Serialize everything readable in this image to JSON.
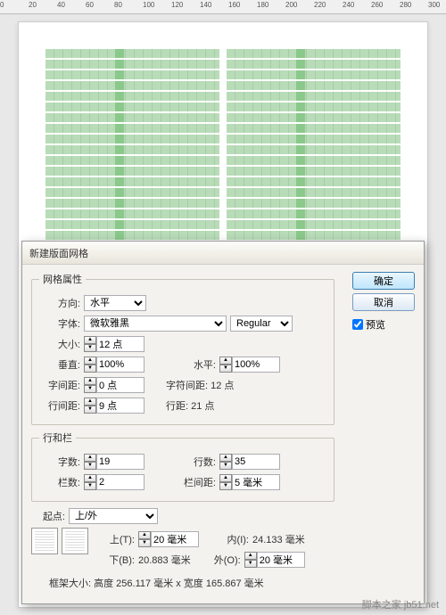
{
  "ruler": [
    "0",
    "20",
    "40",
    "60",
    "80",
    "100",
    "120",
    "140",
    "160",
    "180",
    "200",
    "220",
    "240",
    "260",
    "280",
    "300"
  ],
  "dialog": {
    "title": "新建版面网格",
    "grid_attr": {
      "legend": "网格属性",
      "direction_label": "方向:",
      "direction_value": "水平",
      "font_label": "字体:",
      "font_value": "微软雅黑",
      "font_weight": "Regular",
      "size_label": "大小:",
      "size_value": "12 点",
      "vert_label": "垂直:",
      "vert_value": "100%",
      "horiz_label": "水平:",
      "horiz_value": "100%",
      "char_gap_label": "字间距:",
      "char_gap_value": "0 点",
      "char_gap_info": "字符间距: 12 点",
      "line_gap_label": "行间距:",
      "line_gap_value": "9 点",
      "line_height_info": "行距: 21 点"
    },
    "rows_cols": {
      "legend": "行和栏",
      "chars_label": "字数:",
      "chars_value": "19",
      "lines_label": "行数:",
      "lines_value": "35",
      "cols_label": "栏数:",
      "cols_value": "2",
      "gutter_label": "栏间距:",
      "gutter_value": "5 毫米"
    },
    "origin": {
      "label": "起点:",
      "value": "上/外",
      "top_label": "上(T):",
      "top_value": "20 毫米",
      "inner_label": "内(I):",
      "inner_value": "24.133 毫米",
      "bottom_label": "下(B):",
      "bottom_value": "20.883 毫米",
      "outer_label": "外(O):",
      "outer_value": "20 毫米"
    },
    "frame_size": "框架大小: 高度 256.117 毫米 x 宽度 165.867 毫米",
    "buttons": {
      "ok": "确定",
      "cancel": "取消",
      "preview": "预览"
    }
  },
  "watermark": "脚本之家 jb51.net"
}
